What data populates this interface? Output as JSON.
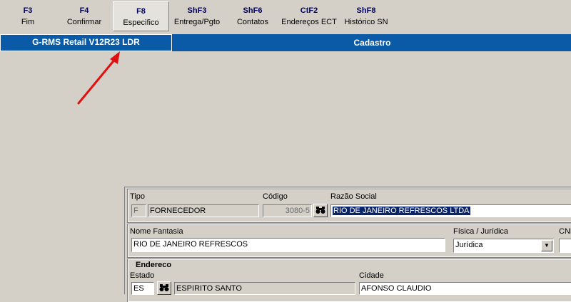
{
  "toolbar": {
    "keys": [
      {
        "key": "F3",
        "label": "Fim"
      },
      {
        "key": "F4",
        "label": "Confirmar"
      },
      {
        "key": "F8",
        "label": "Especifico"
      },
      {
        "key": "ShF3",
        "label": "Entrega/Pgto"
      },
      {
        "key": "ShF6",
        "label": "Contatos"
      },
      {
        "key": "CtF2",
        "label": "Endereços ECT"
      },
      {
        "key": "ShF8",
        "label": "Histórico SN"
      }
    ]
  },
  "titlebar": {
    "app_name": "G-RMS Retail V12R23 LDR",
    "screen_name": "Cadastro"
  },
  "form": {
    "tipo": {
      "label": "Tipo",
      "code": "F",
      "description": "FORNECEDOR"
    },
    "codigo": {
      "label": "Código",
      "value": "3080-5"
    },
    "razao_social": {
      "label": "Razão Social",
      "value": "RIO DE JANEIRO REFRESCOS LTDA"
    },
    "nome_fantasia": {
      "label": "Nome Fantasia",
      "value": "RIO DE JANEIRO REFRESCOS"
    },
    "fisica_juridica": {
      "label": "Física / Jurídica",
      "value": "Jurídica"
    },
    "cnpj": {
      "label": "CNP"
    },
    "endereco": {
      "title": "Endereco",
      "estado": {
        "label": "Estado",
        "code": "ES",
        "name": "ESPIRITO SANTO"
      },
      "cidade": {
        "label": "Cidade",
        "value": "AFONSO CLAUDIO"
      }
    }
  },
  "colors": {
    "titlebar": "#0a5aa8",
    "annotation_arrow": "#e01010",
    "selection": "#0a246a"
  },
  "icons": {
    "search": "binoculars-icon",
    "dropdown": "chevron-down-icon"
  }
}
